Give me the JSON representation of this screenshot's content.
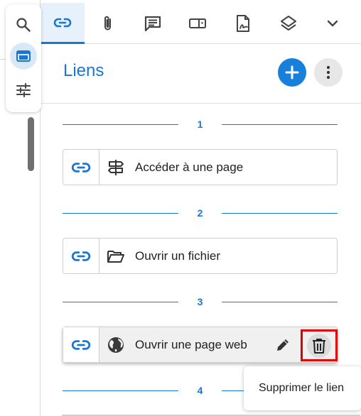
{
  "left_toolbar": {
    "items": [
      {
        "icon": "search-icon",
        "active": false
      },
      {
        "icon": "panel-icon",
        "active": true
      },
      {
        "icon": "sliders-icon",
        "active": false
      }
    ]
  },
  "tabs": [
    {
      "icon": "link-icon",
      "active": true
    },
    {
      "icon": "paperclip-icon",
      "active": false
    },
    {
      "icon": "comment-icon",
      "active": false
    },
    {
      "icon": "form-field-icon",
      "active": false
    },
    {
      "icon": "signature-icon",
      "active": false
    },
    {
      "icon": "layers-icon",
      "active": false
    },
    {
      "icon": "chevron-down-icon",
      "active": false
    }
  ],
  "panel": {
    "title": "Liens",
    "add_icon": "plus-icon",
    "more_icon": "more-vertical-icon"
  },
  "sections": [
    {
      "number": "1",
      "link": {
        "type_icon": "signpost-icon",
        "label": "Accéder à une page"
      }
    },
    {
      "number": "2",
      "link": {
        "type_icon": "folder-open-icon",
        "label": "Ouvrir un fichier"
      }
    },
    {
      "number": "3",
      "link": {
        "type_icon": "globe-icon",
        "label": "Ouvrir une page web",
        "hovered": true
      }
    },
    {
      "number": "4"
    }
  ],
  "tooltip": {
    "text": "Supprimer le lien"
  },
  "colors": {
    "accent": "#1976d2",
    "add_button": "#1680db",
    "delete_highlight": "#e00000"
  }
}
